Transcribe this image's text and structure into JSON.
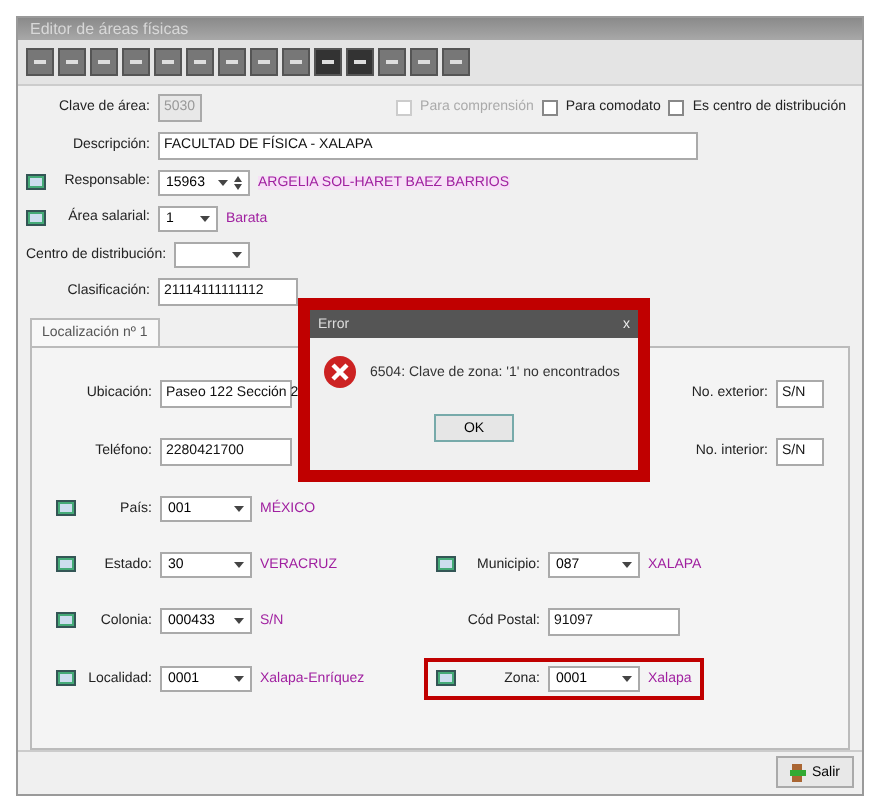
{
  "window": {
    "title": "Editor de áreas físicas"
  },
  "toolbar": {
    "buttons": [
      {
        "kind": "first"
      },
      {
        "kind": "prev-page"
      },
      {
        "kind": "prev"
      },
      {
        "kind": "next"
      },
      {
        "kind": "next-page"
      },
      {
        "kind": "last"
      },
      {
        "kind": "add"
      },
      {
        "kind": "remove"
      },
      {
        "kind": "edit"
      },
      {
        "kind": "accept"
      },
      {
        "kind": "cancel"
      },
      {
        "kind": "refresh"
      },
      {
        "kind": "print"
      },
      {
        "kind": "form"
      }
    ]
  },
  "header": {
    "clave": {
      "label": "Clave de área:",
      "value": "5030",
      "disabled": true
    },
    "checkboxes": [
      {
        "label": "Para comprensión",
        "checked": false,
        "disabled": true
      },
      {
        "label": "Para comodato",
        "checked": false,
        "disabled": false
      },
      {
        "label": "Es centro de distribución",
        "checked": false,
        "disabled": false
      }
    ],
    "fields": [
      {
        "kind": "text",
        "label": "Descripción:",
        "value": "FACULTAD DE FÍSICA - XALAPA"
      },
      {
        "kind": "lookup",
        "label": "Responsable:",
        "value": "15963",
        "spinner": true,
        "lookup_text": "ARGELIA SOL-HARET BAEZ BARRIOS"
      },
      {
        "kind": "lookup",
        "label": "Área salarial:",
        "value": "1",
        "spinner": false,
        "lookup_text": "Barata"
      },
      {
        "kind": "combo",
        "label": "Centro de distribución:"
      },
      {
        "kind": "short",
        "label": "Clasificación:",
        "value": "21114111111112"
      }
    ]
  },
  "tabs": [
    {
      "label": "Localización nº 1",
      "selected": true
    }
  ],
  "location": {
    "rows": [
      {
        "left": {
          "kind": "text",
          "label": "Ubicación:",
          "value": "Paseo 122 Sección 2"
        },
        "right": {
          "kind": "text",
          "label": "No. exterior:",
          "value": "S/N"
        }
      },
      {
        "left": {
          "kind": "text",
          "label": "Teléfono:",
          "value": "2280421700"
        },
        "right": {
          "kind": "text",
          "label": "No. interior:",
          "value": "S/N"
        }
      },
      {
        "left": {
          "kind": "lookup",
          "label": "País:",
          "value": "001",
          "lookup_text": "MÉXICO"
        }
      },
      {
        "left": {
          "kind": "lookup",
          "label": "Estado:",
          "value": "30",
          "lookup_text": "VERACRUZ"
        },
        "right": {
          "kind": "lookup",
          "label": "Municipio:",
          "value": "087",
          "lookup_text": "XALAPA",
          "highlighted": false
        }
      },
      {
        "left": {
          "kind": "lookup",
          "label": "Colonia:",
          "value": "000433",
          "lookup_text": "S/N"
        },
        "right": {
          "kind": "text",
          "label": "Cód Postal:",
          "value": "91097"
        }
      },
      {
        "left": {
          "kind": "lookup",
          "label": "Localidad:",
          "value": "0001",
          "lookup_text": "Xalapa-Enríquez"
        },
        "right": {
          "kind": "lookup",
          "label": "Zona:",
          "value": "0001",
          "lookup_text": "Xalapa",
          "highlighted": true
        }
      }
    ]
  },
  "footer": {
    "button": "Salir"
  },
  "dialog": {
    "title": "Error",
    "close": "x",
    "message": "6504: Clave de zona: '1' no encontrados",
    "button": "OK"
  }
}
